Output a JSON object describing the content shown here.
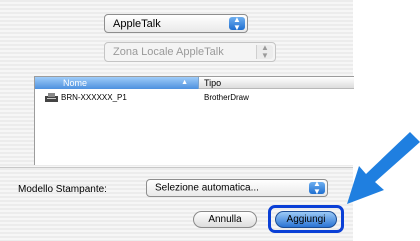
{
  "protocol_popup": {
    "value": "AppleTalk"
  },
  "zone_popup": {
    "value": "Zona Locale AppleTalk"
  },
  "printer_list": {
    "columns": {
      "name": "Nome",
      "type": "Tipo"
    },
    "rows": [
      {
        "name": "BRN-XXXXXX_P1",
        "type": "BrotherDraw",
        "icon": "printer-icon"
      }
    ]
  },
  "printer_model": {
    "label": "Modello Stampante:",
    "value": "Selezione automatica..."
  },
  "buttons": {
    "cancel": "Annulla",
    "add": "Aggiungi"
  },
  "colors": {
    "highlight": "#0a3fd6",
    "arrow": "#1f7fe0",
    "list_header": "#4d91de"
  }
}
